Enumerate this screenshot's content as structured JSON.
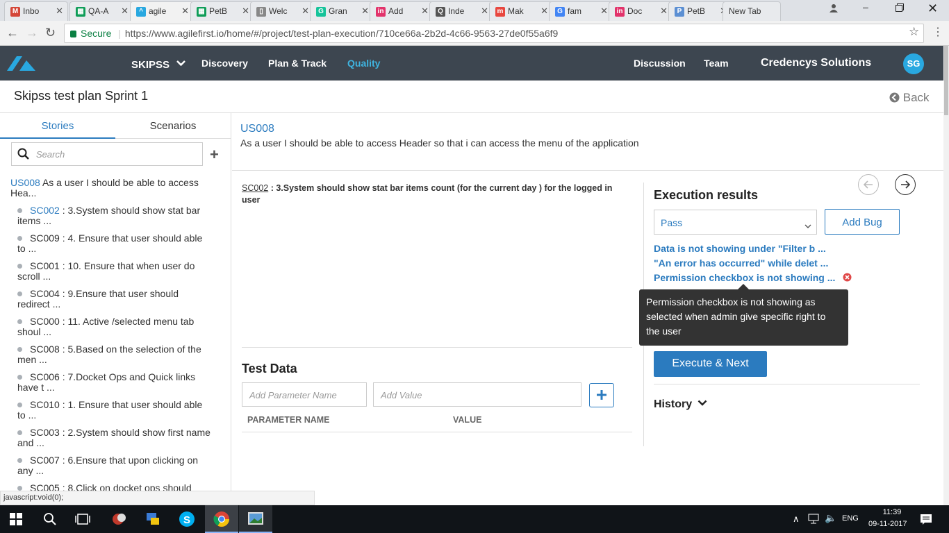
{
  "browser": {
    "tabs": [
      {
        "label": "Inbo",
        "fav": "M",
        "color": "#d44638"
      },
      {
        "label": "QA-A",
        "fav": "▦",
        "color": "#0f9d58"
      },
      {
        "label": "agile",
        "fav": "^",
        "color": "#29a8e0"
      },
      {
        "label": "PetB",
        "fav": "▦",
        "color": "#0f9d58"
      },
      {
        "label": "Welc",
        "fav": "▯",
        "color": "#888888"
      },
      {
        "label": "Gran",
        "fav": "G",
        "color": "#15c39a"
      },
      {
        "label": "Add",
        "fav": "in",
        "color": "#e2336b"
      },
      {
        "label": "Inde",
        "fav": "Q",
        "color": "#555555"
      },
      {
        "label": "Mak",
        "fav": "m",
        "color": "#e8473f"
      },
      {
        "label": "fam",
        "fav": "G",
        "color": "#4285f4"
      },
      {
        "label": "Doc",
        "fav": "in",
        "color": "#e2336b"
      },
      {
        "label": "PetB",
        "fav": "P",
        "color": "#5b8fd3"
      },
      {
        "label": "New Tab",
        "fav": "",
        "color": "#ffffff"
      }
    ],
    "secure_label": "Secure",
    "url": "https://www.agilefirst.io/home/#/project/test-plan-execution/710ce66a-2b2d-4c66-9563-27de0f55a6f9",
    "status_text": "javascript:void(0);"
  },
  "header": {
    "project": "SKIPSS",
    "nav": [
      "Discovery",
      "Plan & Track",
      "Quality"
    ],
    "active_nav": "Quality",
    "right_nav": [
      "Discussion",
      "Team"
    ],
    "org": "Credencys Solutions",
    "avatar": "SG",
    "accent": "#3fb4e0"
  },
  "page": {
    "title": "Skipss test plan Sprint 1",
    "back_label": "Back"
  },
  "sidebar": {
    "tabs": [
      "Stories",
      "Scenarios"
    ],
    "search_placeholder": "Search",
    "story": {
      "id": "US008",
      "text": "As a user I should be able to access",
      "text2": "Hea..."
    },
    "scenarios": [
      {
        "id": "SC002",
        "line1": " : 3.System should show stat bar",
        "line2": "items ...",
        "link": true
      },
      {
        "id": "SC009",
        "line1": " : 4. Ensure that user should able",
        "line2": "to ...",
        "link": false
      },
      {
        "id": "SC001",
        "line1": " : 10. Ensure that when user do",
        "line2": "scroll ...",
        "link": false
      },
      {
        "id": "SC004",
        "line1": " : 9.Ensure that user should",
        "line2": "redirect ...",
        "link": false
      },
      {
        "id": "SC000",
        "line1": " : 11. Active /selected menu tab",
        "line2": "shoul ...",
        "link": false
      },
      {
        "id": "SC008",
        "line1": " : 5.Based on the selection of the",
        "line2": "men ...",
        "link": false
      },
      {
        "id": "SC006",
        "line1": " : 7.Docket Ops and Quick links",
        "line2": "have t ...",
        "link": false
      },
      {
        "id": "SC010",
        "line1": " : 1. Ensure that user should able",
        "line2": "to ...",
        "link": false
      },
      {
        "id": "SC003",
        "line1": " : 2.System should show first name",
        "line2": "and ...",
        "link": false
      },
      {
        "id": "SC007",
        "line1": " : 6.Ensure that upon clicking on",
        "line2": "any ...",
        "link": false
      },
      {
        "id": "SC005",
        "line1": " : 8.Click on docket ops should",
        "line2": "",
        "link": false
      }
    ]
  },
  "story_header": {
    "id": "US008",
    "description": "As a user I should be able to access Header so that i can access the menu of the application"
  },
  "scenario_detail": {
    "id": "SC002",
    "text": " : 3.System should show stat bar items count (for the current day ) for the logged in",
    "text2": "user"
  },
  "test_data": {
    "title": "Test Data",
    "param_placeholder": "Add Parameter Name",
    "value_placeholder": "Add Value",
    "col_param": "PARAMETER NAME",
    "col_value": "VALUE"
  },
  "execution": {
    "title": "Execution results",
    "result_value": "Pass",
    "add_bug_label": "Add Bug",
    "bugs": [
      "Data is not showing under \"Filter b ...",
      "\"An error has occurred\" while delet ...",
      "Permission checkbox is not showing ..."
    ],
    "tooltip": "Permission checkbox is not showing as selected when admin give specific right to the user",
    "execute_label": "Execute & Next",
    "history_label": "History"
  },
  "taskbar": {
    "lang": "ENG",
    "time": "11:39",
    "date": "09-11-2017"
  }
}
